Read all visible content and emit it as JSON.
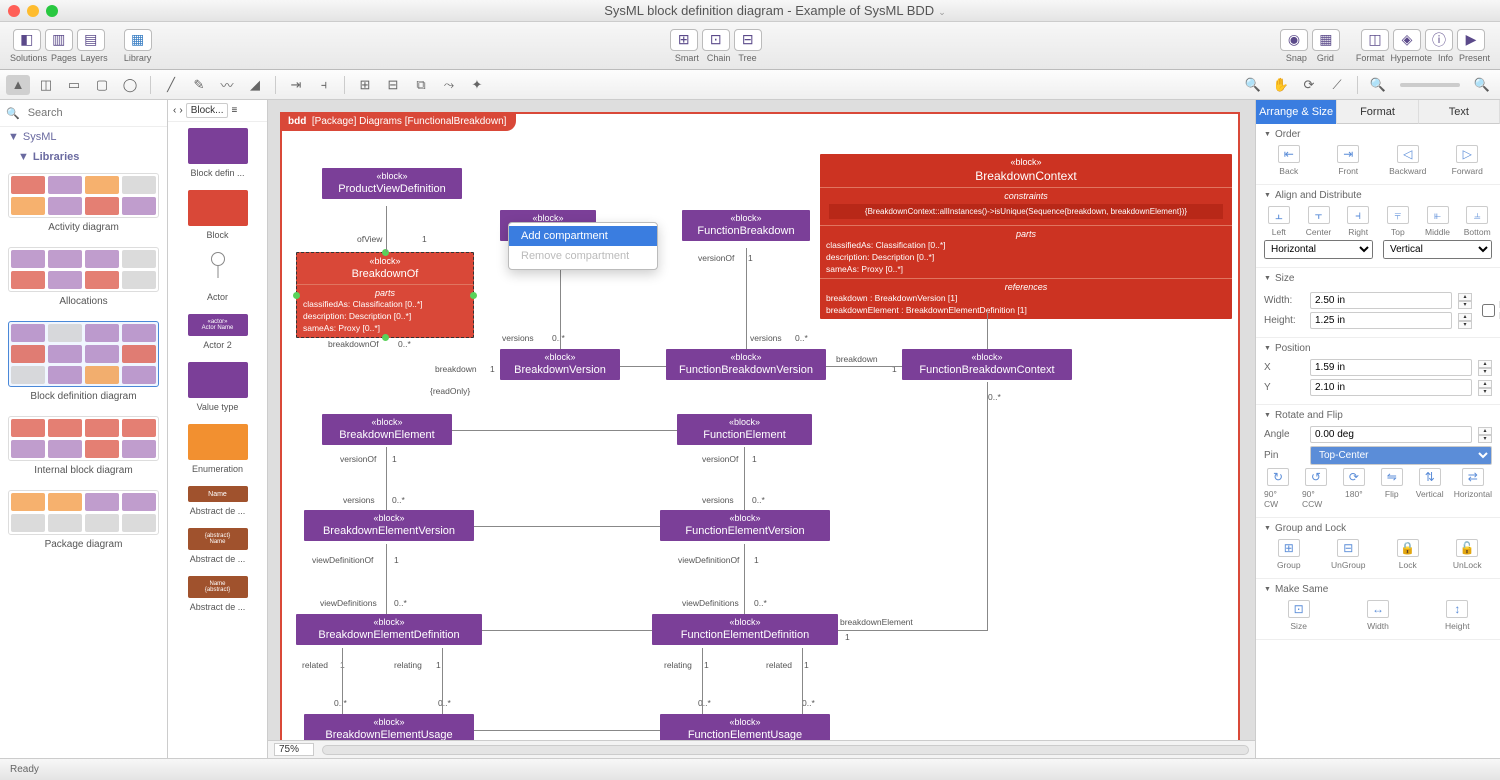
{
  "window": {
    "title": "SysML block definition diagram - Example of SysML BDD"
  },
  "toolbar": {
    "groups": [
      {
        "icons": [
          "◧",
          "▥",
          "▤"
        ],
        "labels": [
          "Solutions",
          "Pages",
          "Layers"
        ]
      },
      {
        "icons": [
          "▦"
        ],
        "labels": [
          "Library"
        ]
      }
    ],
    "right": [
      {
        "icons": [
          "⊞",
          "⊡",
          "⊟"
        ],
        "labels": [
          "Smart",
          "Chain",
          "Tree"
        ]
      },
      {
        "icons": [
          "◉",
          "▦"
        ],
        "labels": [
          "Snap",
          "Grid"
        ]
      },
      {
        "icons": [
          "◫",
          "◈",
          "ⓘ",
          "▶"
        ],
        "labels": [
          "Format",
          "Hypernote",
          "Info",
          "Present"
        ]
      }
    ]
  },
  "tools": [
    "pointer",
    "marquee",
    "rect",
    "roundrect",
    "ellipse",
    "line",
    "pen",
    "curve",
    "eraser",
    "a",
    "b",
    "c",
    "d",
    "e",
    "zoom",
    "pan",
    "rotate",
    "eyedrop"
  ],
  "sidebar_left": {
    "search_placeholder": "Search",
    "root": "SysML",
    "section": "Libraries",
    "items": [
      {
        "label": "Activity diagram",
        "selected": false
      },
      {
        "label": "Allocations",
        "selected": false
      },
      {
        "label": "Block definition diagram",
        "selected": true
      },
      {
        "label": "Internal block diagram",
        "selected": false
      },
      {
        "label": "Package diagram",
        "selected": false
      }
    ]
  },
  "stencil": {
    "nav_label": "Block...",
    "items": [
      {
        "label": "Block defin ...",
        "color": "purple"
      },
      {
        "label": "Block",
        "color": "red"
      },
      {
        "label": "Actor",
        "color": "actor"
      },
      {
        "label": "Actor 2",
        "color": "purple"
      },
      {
        "label": "Value type",
        "color": "purple"
      },
      {
        "label": "Enumeration",
        "color": "orange"
      },
      {
        "label": "Abstract de ...",
        "color": "brown"
      },
      {
        "label": "Abstract de ...",
        "color": "brown"
      },
      {
        "label": "Abstract de ...",
        "color": "brown"
      }
    ]
  },
  "canvas": {
    "frame_label": "bdd  [Package] Diagrams [FunctionalBreakdown]",
    "zoom": "75%",
    "context_menu": {
      "add": "Add compartment",
      "remove": "Remove compartment"
    },
    "blocks": {
      "ProductViewDefinition": {
        "st": "«block»",
        "name": "ProductViewDefinition"
      },
      "BreakdownOf": {
        "st": "«block»",
        "name": "BreakdownOf",
        "parts_title": "parts",
        "parts": [
          "classifiedAs: Classification [0..*]",
          "description: Description [0..*]",
          "sameAs: Proxy [0..*]"
        ]
      },
      "FunctionBreakdown": {
        "st": "«block»",
        "name": "FunctionBreakdown"
      },
      "BreakdownContext": {
        "st": "«block»",
        "name": "BreakdownContext",
        "constraints_title": "constraints",
        "constraint": "{BreakdownContext::allInstances()->isUnique(Sequence{breakdown, breakdownElement})}",
        "parts_title": "parts",
        "parts": [
          "classifiedAs: Classification [0..*]",
          "description: Description [0..*]",
          "sameAs: Proxy [0..*]"
        ],
        "refs_title": "references",
        "refs": [
          "breakdown : BreakdownVersion [1]",
          "breakdownElement : BreakdownElementDefinition [1]"
        ]
      },
      "BreakdownVersion": {
        "st": "«block»",
        "name": "BreakdownVersion"
      },
      "FunctionBreakdownVersion": {
        "st": "«block»",
        "name": "FunctionBreakdownVersion"
      },
      "FunctionBreakdownContext": {
        "st": "«block»",
        "name": "FunctionBreakdownContext"
      },
      "BreakdownElement": {
        "st": "«block»",
        "name": "BreakdownElement"
      },
      "FunctionElement": {
        "st": "«block»",
        "name": "FunctionElement"
      },
      "BreakdownElementVersion": {
        "st": "«block»",
        "name": "BreakdownElementVersion"
      },
      "FunctionElementVersion": {
        "st": "«block»",
        "name": "FunctionElementVersion"
      },
      "BreakdownElementDefinition": {
        "st": "«block»",
        "name": "BreakdownElementDefinition"
      },
      "FunctionElementDefinition": {
        "st": "«block»",
        "name": "FunctionElementDefinition"
      },
      "BreakdownElementUsage": {
        "st": "«block»",
        "name": "BreakdownElementUsage"
      },
      "FunctionElementUsage": {
        "st": "«block»",
        "name": "FunctionElementUsage"
      }
    },
    "assoc_labels": {
      "ofView": "ofView",
      "one": "1",
      "versionOf": "versionOf",
      "versions": "versions",
      "zerostar": "0..*",
      "breakdownOf": "breakdownOf",
      "breakdown": "breakdown",
      "readOnly": "{readOnly}",
      "viewDefinitionOf": "viewDefinitionOf",
      "viewDefinitions": "viewDefinitions",
      "related": "related",
      "relating": "relating",
      "breakdownElement": "breakdownElement"
    }
  },
  "props": {
    "tabs": [
      "Arrange & Size",
      "Format",
      "Text"
    ],
    "order": {
      "title": "Order",
      "btns": [
        "Back",
        "Front",
        "Backward",
        "Forward"
      ]
    },
    "align": {
      "title": "Align and Distribute",
      "btns": [
        "Left",
        "Center",
        "Right",
        "Top",
        "Middle",
        "Bottom"
      ],
      "h": "Horizontal",
      "v": "Vertical"
    },
    "size": {
      "title": "Size",
      "width_label": "Width:",
      "width": "2.50 in",
      "height_label": "Height:",
      "height": "1.25 in",
      "lock": "Lock Proportions"
    },
    "position": {
      "title": "Position",
      "x_label": "X",
      "x": "1.59 in",
      "y_label": "Y",
      "y": "2.10 in"
    },
    "rotate": {
      "title": "Rotate and Flip",
      "angle_label": "Angle",
      "angle": "0.00 deg",
      "pin_label": "Pin",
      "pin": "Top-Center",
      "btns": [
        "90° CW",
        "90° CCW",
        "180°",
        "Flip",
        "Vertical",
        "Horizontal"
      ]
    },
    "group": {
      "title": "Group and Lock",
      "btns": [
        "Group",
        "UnGroup",
        "Lock",
        "UnLock"
      ]
    },
    "same": {
      "title": "Make Same",
      "btns": [
        "Size",
        "Width",
        "Height"
      ]
    }
  },
  "status": "Ready"
}
